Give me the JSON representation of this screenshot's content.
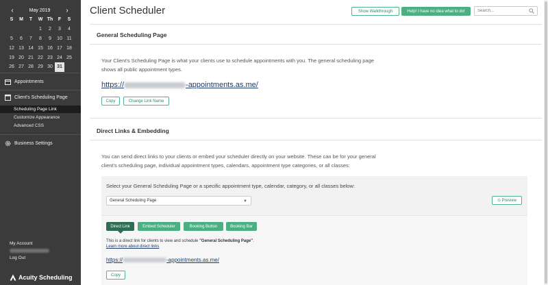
{
  "calendar": {
    "month_label": "May 2019",
    "prev_arrow": "‹",
    "next_arrow": "›",
    "weekdays": [
      "S",
      "M",
      "T",
      "W",
      "Th",
      "F",
      "S"
    ],
    "weeks": [
      [
        "",
        "",
        "",
        "1",
        "2",
        "3",
        "4"
      ],
      [
        "5",
        "6",
        "7",
        "8",
        "9",
        "10",
        "11"
      ],
      [
        "12",
        "13",
        "14",
        "15",
        "16",
        "17",
        "18"
      ],
      [
        "19",
        "20",
        "21",
        "22",
        "23",
        "24",
        "25"
      ],
      [
        "26",
        "27",
        "28",
        "29",
        "30",
        "31",
        ""
      ]
    ],
    "selected_day": "31"
  },
  "sidebar": {
    "appointments": "Appointments",
    "clients_scheduling_page": "Client's Scheduling Page",
    "sub_items": [
      "Scheduling Page Link",
      "Customize Appearance",
      "Advanced CSS"
    ],
    "active_sub": 0,
    "business_settings": "Business Settings",
    "my_account": "My Account",
    "log_out": "Log Out",
    "brand": "Acuity Scheduling"
  },
  "header": {
    "title": "Client Scheduler",
    "walkthrough_button": "Show Walkthrough",
    "help_button": "Help! I have no idea what to do!",
    "search_placeholder": "Search..."
  },
  "general": {
    "title": "General Scheduling Page",
    "description_line1": "Your Client's Scheduling Page is what your clients use to schedule appointments with you. The general scheduling page",
    "description_line2": "shows all public appointment types.",
    "link_prefix": "https://",
    "link_suffix": "-appointments.as.me/",
    "copy_button": "Copy",
    "change_link_button": "Change Link Name"
  },
  "direct": {
    "title": "Direct Links & Embedding",
    "description_line1": "You can send direct links to your clients or embed your scheduler directly on your website. These can be for your general",
    "description_line2": "client's scheduling page, individual appointment types, calendars, appointment type categories, or all classes:",
    "prompt": "Select your General Scheduling Page or a specific appointment type, calendar, category, or all classes below:",
    "selected_option": "General Scheduling Page",
    "preview_button": "⊙ Preview",
    "tabs": [
      "Direct Link",
      "Embed Scheduler",
      "Booking Button",
      "Booking Bar"
    ],
    "active_tab": 0,
    "desc_prefix": "This is a direct link for clients to view and schedule ",
    "desc_bold": "\"General Scheduling Page\"",
    "desc_suffix": ".",
    "learn_more": "Learn more about direct links",
    "link_prefix": "https://",
    "link_suffix": "-appointments.as.me/",
    "copy_button": "Copy"
  },
  "colors": {
    "sidebar_bg": "#3b3b3b",
    "accent_green": "#4caf82",
    "active_tab": "#2f6e55",
    "link_blue": "#1a3a6b"
  }
}
